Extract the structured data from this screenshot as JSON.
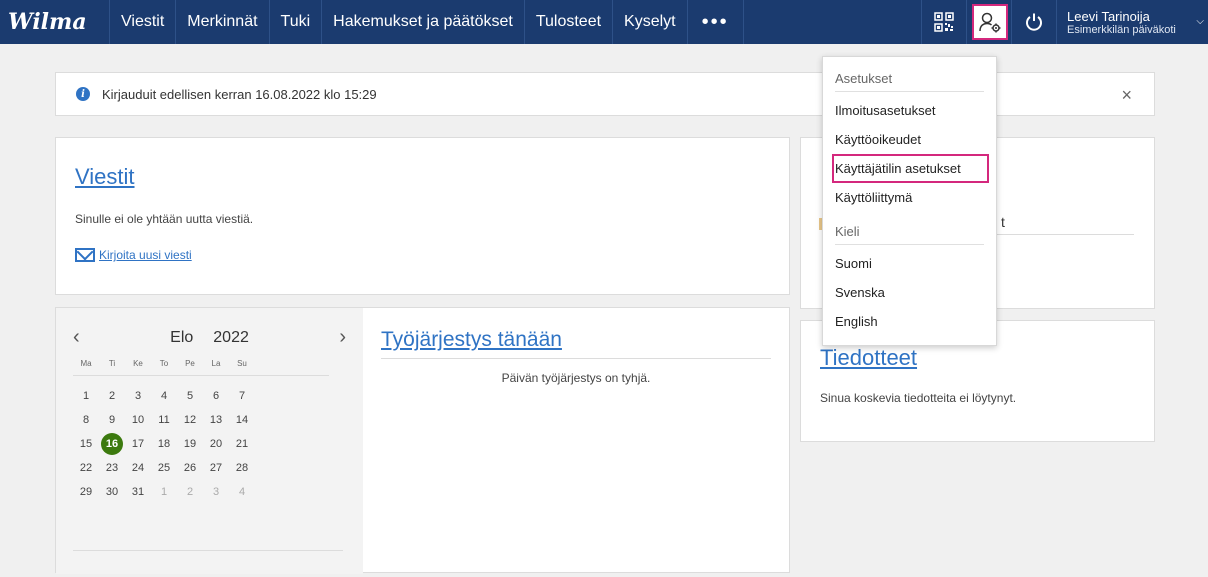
{
  "app": {
    "logo": "Wilma"
  },
  "nav": {
    "items": [
      "Viestit",
      "Merkinnät",
      "Tuki",
      "Hakemukset ja päätökset",
      "Tulosteet",
      "Kyselyt"
    ],
    "more": "•••"
  },
  "user": {
    "name": "Leevi Tarinoija",
    "org": "Esimerkkilän päiväkoti"
  },
  "notice": {
    "text": "Kirjauduit edellisen kerran 16.08.2022 klo 15:29",
    "close": "×"
  },
  "messages": {
    "title": "Viestit",
    "empty": "Sinulle ei ole yhtään uutta viestiä.",
    "new_link": "Kirjoita uusi viesti"
  },
  "calendar": {
    "month": "Elo",
    "year": "2022",
    "prev": "‹",
    "next": "›",
    "weekdays": [
      "Ma",
      "Ti",
      "Ke",
      "To",
      "Pe",
      "La",
      "Su"
    ],
    "weeks": [
      [
        "1",
        "2",
        "3",
        "4",
        "5",
        "6",
        "7"
      ],
      [
        "8",
        "9",
        "10",
        "11",
        "12",
        "13",
        "14"
      ],
      [
        "15",
        "16",
        "17",
        "18",
        "19",
        "20",
        "21"
      ],
      [
        "22",
        "23",
        "24",
        "25",
        "26",
        "27",
        "28"
      ],
      [
        "29",
        "30",
        "31",
        "1",
        "2",
        "3",
        "4"
      ]
    ],
    "today": "16"
  },
  "schedule": {
    "title": "Työjärjestys tänään",
    "empty": "Päivän työjärjestys on tyhjä."
  },
  "right_card": {
    "partial_text": "t"
  },
  "announcements": {
    "title": "Tiedotteet",
    "empty": "Sinua koskevia tiedotteita ei löytynyt."
  },
  "dropdown": {
    "section1": "Asetukset",
    "items1": [
      "Ilmoitusasetukset",
      "Käyttöoikeudet",
      "Käyttäjätilin asetukset",
      "Käyttöliittymä"
    ],
    "section2": "Kieli",
    "items2": [
      "Suomi",
      "Svenska",
      "English"
    ]
  },
  "colors": {
    "navbar": "#1b3b6f",
    "link": "#2f73c4",
    "highlight": "#d4287d",
    "today": "#3c7a0e"
  }
}
